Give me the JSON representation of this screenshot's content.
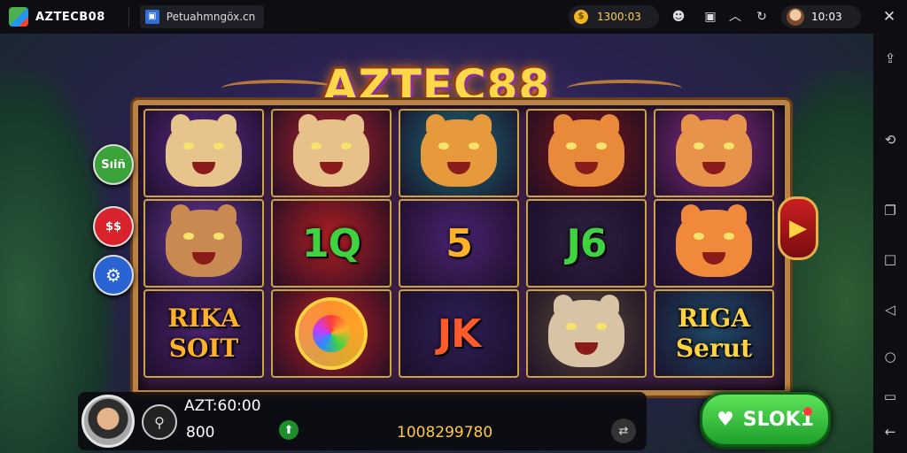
{
  "window": {
    "app_title": "AZTECB08",
    "tab_title": "Petuahmngöx.cn",
    "tab_icon": "app-tab-icon",
    "coin_balance": "1300:03",
    "profile_value": "10:03"
  },
  "toolbar_icons": [
    "coin-icon",
    "user-mask-icon",
    "screenshot-icon",
    "chevron-up-icon",
    "refresh-icon",
    "profile-avatar-icon",
    "close-icon"
  ],
  "side_nav_icons": [
    "share-icon",
    "rotate-icon",
    "copy-icon",
    "square-icon",
    "back-shape-icon",
    "circle-icon",
    "recents-icon",
    "back-arrow-icon"
  ],
  "game": {
    "logo": "AZTEC88",
    "side_buttons": [
      {
        "label": "Sıiñ",
        "color": "#3aa33a"
      },
      {
        "label": "$$",
        "color": "#d9232c"
      },
      {
        "label": "⚙",
        "color": "#2a63d4"
      }
    ],
    "reels": [
      [
        {
          "type": "beast",
          "name": "jester-beast",
          "bg": "#5a2b8a",
          "fur": "#e6c48c"
        },
        {
          "type": "beast",
          "name": "purple-tiger",
          "bg": "#6a3aa0",
          "fur": "#c98a52"
        },
        {
          "type": "word",
          "text": "RIKA SOIT",
          "bg": "#4a2371",
          "color": "#ffb12a"
        }
      ],
      [
        {
          "type": "beast",
          "name": "jester-cat",
          "bg": "#b2242a",
          "fur": "#e8c08a"
        },
        {
          "type": "letters",
          "text": "1Q",
          "bg": "#b01e22",
          "color": "#3fd43f"
        },
        {
          "type": "wheel",
          "name": "gem-wheel",
          "bg": "#b61e23",
          "color": "#ff9a2a"
        }
      ],
      [
        {
          "type": "beast",
          "name": "tiger-mic",
          "bg": "#1c6a78",
          "fur": "#e79a3b"
        },
        {
          "type": "letters",
          "text": "5",
          "bg": "#4a2371",
          "color": "#ffb12a"
        },
        {
          "type": "letters",
          "text": "JK",
          "bg": "#2e1f58",
          "color": "#ff5a2a"
        }
      ],
      [
        {
          "type": "beast",
          "name": "heart-tiger",
          "bg": "#7a1818",
          "fur": "#e98a3b"
        },
        {
          "type": "letters",
          "text": "J6",
          "bg": "#2e1f42",
          "color": "#3fd43f"
        },
        {
          "type": "beast",
          "name": "white-tiger",
          "bg": "#5a4a3a",
          "fur": "#d9c3a5"
        }
      ],
      [
        {
          "type": "beast",
          "name": "magenta-tiger",
          "bg": "#8a2e8a",
          "fur": "#e8934a"
        },
        {
          "type": "beast",
          "name": "roaring-tiger",
          "bg": "#3a1f5a",
          "fur": "#f08a3a"
        },
        {
          "type": "word",
          "text": "RIGA Serut",
          "bg": "#1e4a6a",
          "color": "#ffd23f"
        }
      ]
    ],
    "next_arrow": "▶",
    "bottom": {
      "timer": "AZT:60:00",
      "bet": "800",
      "win_amount": "1008299780",
      "spin_label": "SLOK1"
    },
    "colors": {
      "frame_gold": "#b88344",
      "spin_green": "#2cbf34",
      "logo_gold": "#ffd84a"
    }
  }
}
